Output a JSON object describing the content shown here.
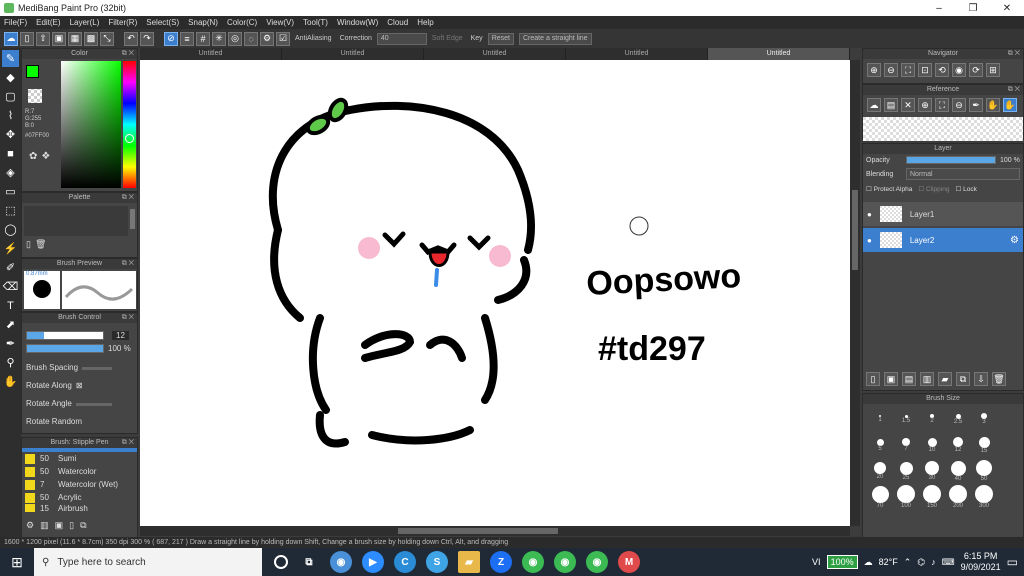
{
  "titlebar": {
    "title": "MediBang Paint Pro (32bit)",
    "min": "–",
    "max": "❐",
    "close": "✕"
  },
  "menu": [
    "File(F)",
    "Edit(E)",
    "Layer(L)",
    "Filter(R)",
    "Select(S)",
    "Snap(N)",
    "Color(C)",
    "View(V)",
    "Tool(T)",
    "Window(W)",
    "Cloud",
    "Help"
  ],
  "toolbar": {
    "antialias": "AntiAliasing",
    "correction_label": "Correction",
    "correction_value": "40",
    "soft_edge": "Soft Edge",
    "key": "Key",
    "reset": "Reset",
    "straight_line": "Create a straight line"
  },
  "tabs": [
    "Untitled",
    "Untitled",
    "Untitled",
    "Untitled",
    "Untitled"
  ],
  "color": {
    "title": "Color",
    "r": "R:7",
    "g": "G:255",
    "b": "B:0",
    "hex": "#07FF00",
    "fg": "#07FF00"
  },
  "palette": {
    "title": "Palette"
  },
  "brush_preview": {
    "title": "Brush Preview",
    "size": "0.87mm"
  },
  "brush_control": {
    "title": "Brush Control",
    "size_value": "12",
    "opacity_value": "100 %",
    "items": [
      "Brush Spacing",
      "Rotate Along",
      "Rotate Angle",
      "Rotate Random"
    ]
  },
  "brush_list": {
    "title": "Brush: Stipple Pen",
    "items": [
      {
        "size": "50",
        "name": "Sumi",
        "color": "#f2d81a"
      },
      {
        "size": "50",
        "name": "Watercolor",
        "color": "#f2d81a"
      },
      {
        "size": "7",
        "name": "Watercolor (Wet)",
        "color": "#f2d81a"
      },
      {
        "size": "50",
        "name": "Acrylic",
        "color": "#f2d81a"
      },
      {
        "size": "15",
        "name": "Airbrush",
        "color": "#f2d81a"
      }
    ]
  },
  "canvas": {
    "text1": "Oopsowo",
    "text2": "#td297"
  },
  "navigator": {
    "title": "Navigator"
  },
  "reference": {
    "title": "Reference"
  },
  "layer": {
    "title": "Layer",
    "opacity_label": "Opacity",
    "opacity_value": "100 %",
    "blending_label": "Blending",
    "blending_value": "Normal",
    "protect_alpha": "Protect Alpha",
    "clipping": "Clipping",
    "lock": "Lock",
    "layers": [
      {
        "name": "Layer1",
        "selected": false
      },
      {
        "name": "Layer2",
        "selected": true
      }
    ]
  },
  "brush_size": {
    "title": "Brush Size",
    "values": [
      "1",
      "1.5",
      "2",
      "2.5",
      "3",
      "5",
      "7",
      "10",
      "12",
      "15",
      "20",
      "25",
      "30",
      "40",
      "50",
      "70",
      "100",
      "150",
      "200",
      "300"
    ]
  },
  "statusbar": "1600 * 1200 pixel   (11.6 * 8.7cm)   350 dpi   300 %   ( 687, 217 )   Draw a straight line by holding down Shift, Change a brush size by holding down Ctrl, Alt, and dragging",
  "taskbar": {
    "search_placeholder": "Type here to search",
    "battery": "100%",
    "weather": "82°F",
    "time": "6:15 PM",
    "date": "9/09/2021"
  }
}
